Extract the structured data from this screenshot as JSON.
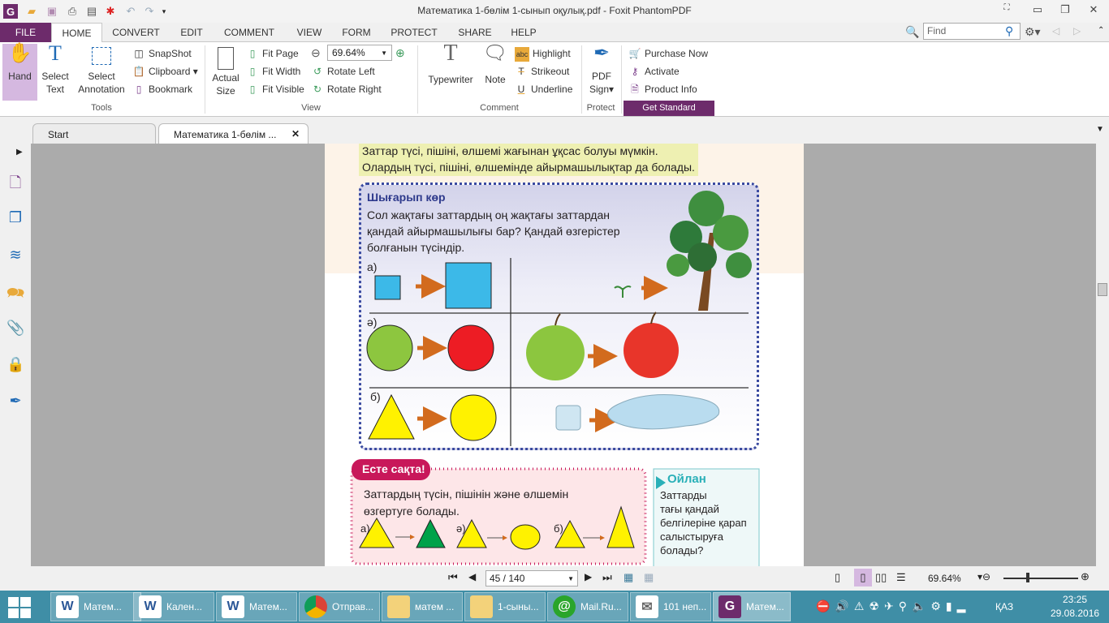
{
  "window": {
    "title": "Математика 1-бөлім 1-сынып оқулық.pdf - Foxit PhantomPDF"
  },
  "menu": {
    "tabs": [
      "FILE",
      "HOME",
      "CONVERT",
      "EDIT",
      "COMMENT",
      "VIEW",
      "FORM",
      "PROTECT",
      "SHARE",
      "HELP"
    ],
    "find_placeholder": "Find"
  },
  "ribbon": {
    "tools": {
      "hand": "Hand",
      "select_text": [
        "Select",
        "Text"
      ],
      "select_annotation": [
        "Select",
        "Annotation"
      ],
      "snapshot": "SnapShot",
      "clipboard": "Clipboard",
      "bookmark": "Bookmark",
      "group": "Tools"
    },
    "view": {
      "actual_size": [
        "Actual",
        "Size"
      ],
      "fit_page": "Fit Page",
      "fit_width": "Fit Width",
      "fit_visible": "Fit Visible",
      "zoom": "69.64%",
      "rotate_left": "Rotate Left",
      "rotate_right": "Rotate Right",
      "group": "View"
    },
    "comment": {
      "typewriter": "Typewriter",
      "note": "Note",
      "highlight": "Highlight",
      "strikeout": "Strikeout",
      "underline": "Underline",
      "group": "Comment"
    },
    "protect": {
      "pdf_sign": [
        "PDF",
        "Sign"
      ],
      "group": "Protect"
    },
    "standard": {
      "purchase": "Purchase Now",
      "activate": "Activate",
      "product_info": "Product Info",
      "get_standard": "Get Standard"
    }
  },
  "doc_tabs": [
    "Start",
    "Математика 1-бөлім ..."
  ],
  "page": {
    "intro": [
      "Заттар түсі, пішіні, өлшемі жағынан ұқсас болуы мүмкін.",
      "Олардың түсі, пішіні, өлшемінде айырмашылықтар да болады."
    ],
    "task_title": "Шығарып көр",
    "task_text": [
      "Сол жақтағы заттардың оң жақтағы заттардан",
      "қандай айырмашылығы бар? Қандай өзгерістер",
      "болғанын түсіндір."
    ],
    "row_labels": [
      "а)",
      "ә)",
      "б)"
    ],
    "remember_title": "Есте сақта!",
    "remember_text": [
      "Заттардың түсін, пішінін және өлшемін",
      "өзгертуге болады."
    ],
    "think_title": "Ойлан",
    "think_text": [
      "Заттарды",
      "тағы қандай",
      "белгілеріне қарап",
      "салыстыруға",
      "болады?"
    ]
  },
  "status": {
    "page": "45 / 140",
    "zoom": "69.64%"
  },
  "taskbar": {
    "items": [
      "Матем...",
      "Кален...",
      "Матем...",
      "Отправ...",
      "матем ...",
      "1-сыны...",
      "Mail.Ru...",
      "101 неп...",
      "Матем..."
    ],
    "lang": "ҚАЗ",
    "time": "23:25",
    "date": "29.08.2016"
  },
  "colors": {
    "brand": "#6d2b6b",
    "taskbar": "#3f8ea6",
    "blue_square": "#3cb9e8",
    "green": "#8dc63f",
    "red": "#ed1c24",
    "yellow": "#fff200",
    "arrow": "#d26b1e"
  }
}
